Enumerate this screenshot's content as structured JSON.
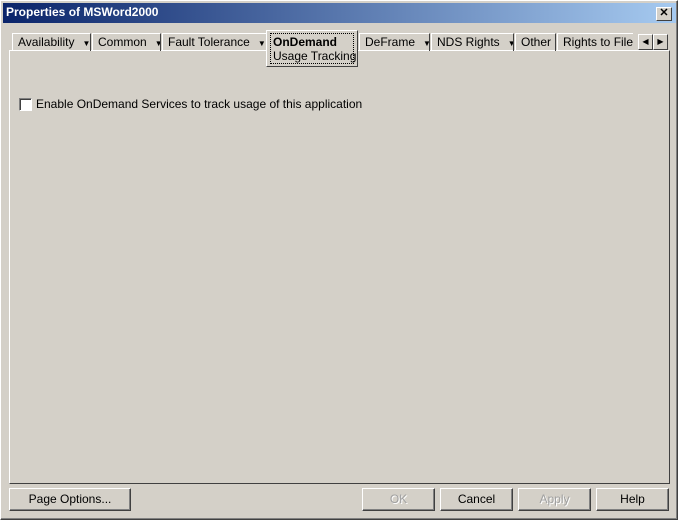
{
  "window": {
    "title": "Properties of MSWord2000",
    "close": "✕"
  },
  "tabs": [
    {
      "label": "Availability",
      "dropdown": true
    },
    {
      "label": "Common",
      "dropdown": true
    },
    {
      "label": "Fault Tolerance",
      "dropdown": true
    },
    {
      "label": "OnDemand",
      "sublabel": "Usage Tracking",
      "active": true
    },
    {
      "label": "DeFrame",
      "dropdown": true
    },
    {
      "label": "NDS Rights",
      "dropdown": true
    },
    {
      "label": "Other"
    },
    {
      "label": "Rights to Files"
    }
  ],
  "scroll": {
    "left": "◀",
    "right": "▶"
  },
  "arrow": "▼",
  "content": {
    "checkbox_label": "Enable OnDemand Services to track usage of this application",
    "checked": false
  },
  "buttons": {
    "page_options": "Page Options...",
    "ok": "OK",
    "cancel": "Cancel",
    "apply": "Apply",
    "help": "Help"
  }
}
